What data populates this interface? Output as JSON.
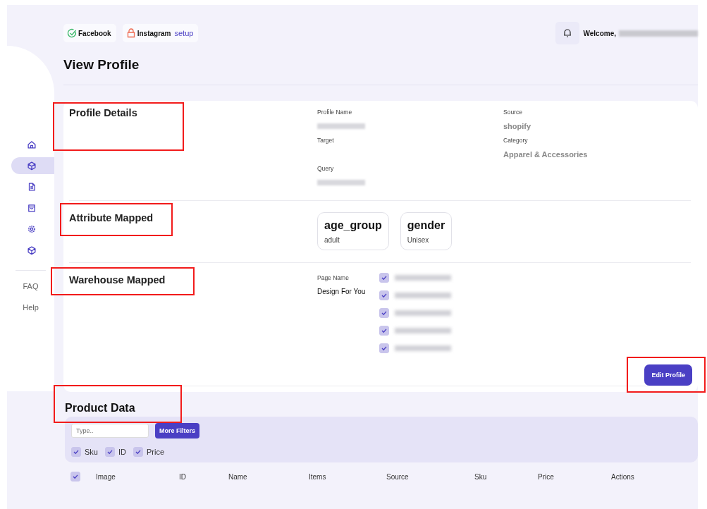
{
  "header": {
    "channels": [
      {
        "name": "Facebook",
        "kind": "connected"
      },
      {
        "name": "Instagram",
        "kind": "locked",
        "action": "setup"
      }
    ],
    "welcome": "Welcome,",
    "welcome_name_redacted": true
  },
  "title": "View Profile",
  "sidebar": {
    "items": [
      {
        "kind": "home",
        "selected": false
      },
      {
        "kind": "cube",
        "selected": true
      },
      {
        "kind": "document",
        "selected": false
      },
      {
        "kind": "bag",
        "selected": false
      },
      {
        "kind": "gear",
        "selected": false
      },
      {
        "kind": "cube",
        "selected": false
      }
    ],
    "links": [
      "FAQ",
      "Help"
    ]
  },
  "profile_details": {
    "heading": "Profile Details",
    "highlighted": true,
    "fields": [
      {
        "label": "Profile Name",
        "redacted": true
      },
      {
        "label": "Source",
        "value": "shopify"
      },
      {
        "label": "Target"
      },
      {
        "label": "Category",
        "value": "Apparel & Accessories"
      },
      {
        "label": "Query",
        "redacted": true
      }
    ]
  },
  "attribute_mapped": {
    "heading": "Attribute Mapped",
    "highlighted": true,
    "attributes": [
      {
        "name": "age_group",
        "value": "adult"
      },
      {
        "name": "gender",
        "value": "Unisex"
      }
    ]
  },
  "warehouse_mapped": {
    "heading": "Warehouse Mapped",
    "highlighted": true,
    "page_label": "Page Name",
    "page_name": "Design For You",
    "warehouses": [
      {
        "checked": true,
        "redacted": true
      },
      {
        "checked": true,
        "redacted": true
      },
      {
        "checked": true,
        "redacted": true
      },
      {
        "checked": true,
        "redacted": true
      },
      {
        "checked": true,
        "redacted": true
      }
    ]
  },
  "edit_button": {
    "label": "Edit Profile",
    "highlighted": true
  },
  "product_data": {
    "heading": "Product Data",
    "highlighted": true,
    "search": {
      "placeholder": "Type.."
    },
    "filter_button": "More Filters",
    "column_toggles": [
      {
        "label": "Sku",
        "checked": true
      },
      {
        "label": "ID",
        "checked": true
      },
      {
        "label": "Price",
        "checked": true
      }
    ],
    "table": {
      "select_all_checked": true,
      "columns": [
        "Image",
        "ID",
        "Name",
        "Items",
        "Source",
        "Sku",
        "Price",
        "Actions"
      ]
    }
  }
}
